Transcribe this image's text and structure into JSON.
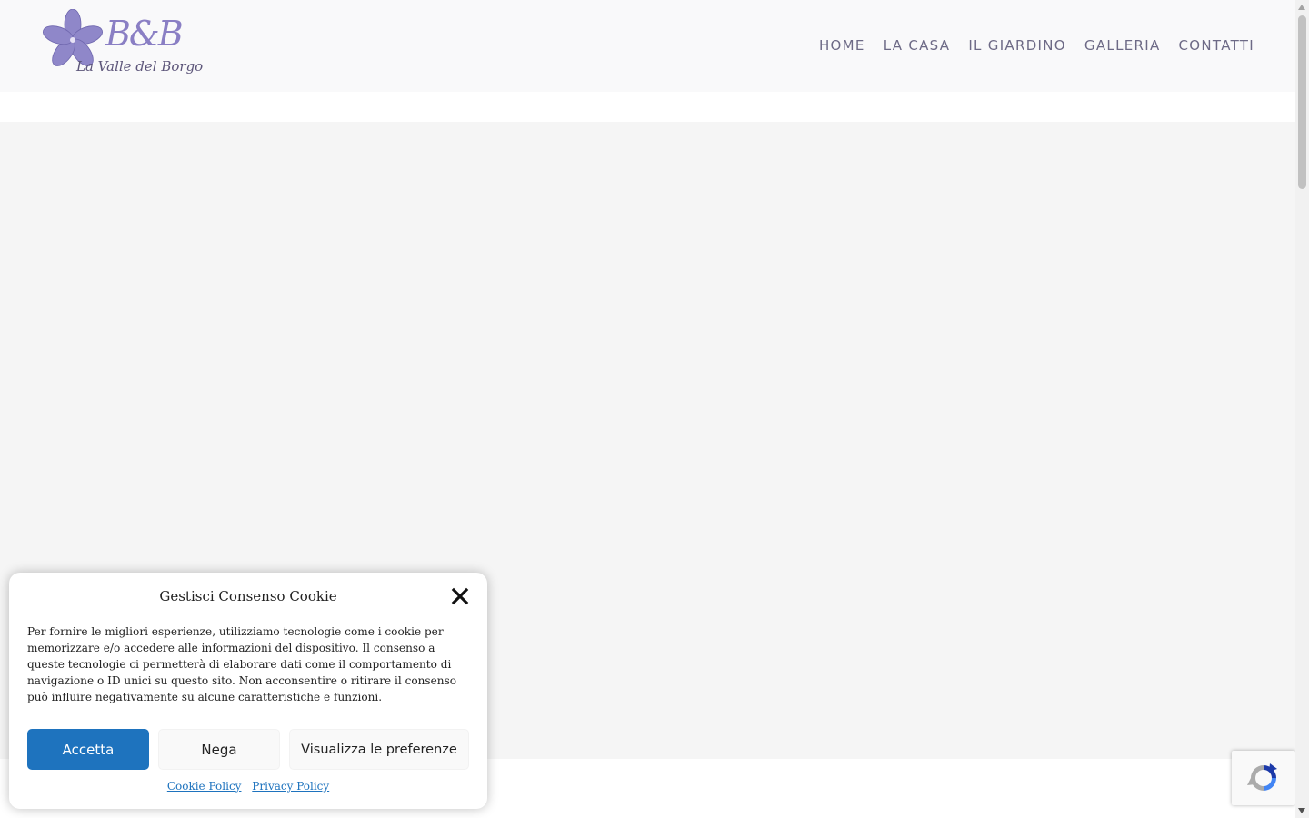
{
  "header": {
    "logo": {
      "brand": "B&B",
      "subtitle": "La Valle del Borgo",
      "flower_color": "#8f87c9"
    },
    "nav": [
      {
        "label": "HOME"
      },
      {
        "label": "LA CASA"
      },
      {
        "label": "IL GIARDINO"
      },
      {
        "label": "GALLERIA"
      },
      {
        "label": "CONTATTI"
      }
    ],
    "nav_color": "#6d6a86"
  },
  "cookie_banner": {
    "title": "Gestisci Consenso Cookie",
    "message": "Per fornire le migliori esperienze, utilizziamo tecnologie come i cookie per memorizzare e/o accedere alle informazioni del dispositivo. Il consenso a queste tecnologie ci permetterà di elaborare dati come il comportamento di navigazione o ID unici su questo sito. Non acconsentire o ritirare il consenso può influire negativamente su alcune caratteristiche e funzioni.",
    "buttons": {
      "accept": "Accetta",
      "deny": "Nega",
      "preferences": "Visualizza le preferenze"
    },
    "links": {
      "cookie_policy": "Cookie Policy",
      "privacy_policy": "Privacy Policy"
    },
    "accent_color": "#1e73be",
    "close_icon": "close-icon"
  },
  "recaptcha": {
    "icon": "recaptcha-icon"
  }
}
